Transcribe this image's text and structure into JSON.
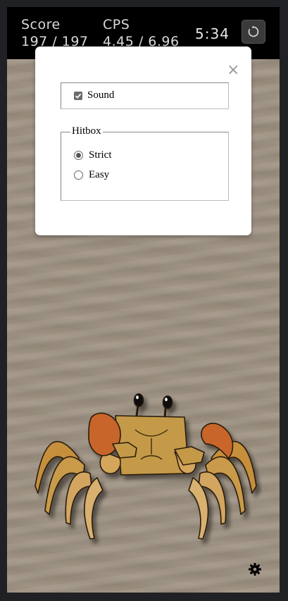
{
  "hud": {
    "score_label": "Score",
    "score_value": "197 / 197",
    "cps_label": "CPS",
    "cps_value": "4.45 / 6.96",
    "timer": "5:34",
    "restart_icon": "restart-icon"
  },
  "settings_modal": {
    "close_icon": "close-icon",
    "sound_label": "Sound",
    "sound_checked": true,
    "hitbox_legend": "Hitbox",
    "hitbox_options": [
      "Strict",
      "Easy"
    ],
    "hitbox_selected": "Strict"
  },
  "game": {
    "sprite": "ghost-crab",
    "settings_icon": "gear-icon"
  },
  "colors": {
    "background": "#202124",
    "hud_bg": "#000000",
    "sand": "#9d9181",
    "crab_body": "#c49a4a",
    "crab_claw": "#c8652a"
  }
}
